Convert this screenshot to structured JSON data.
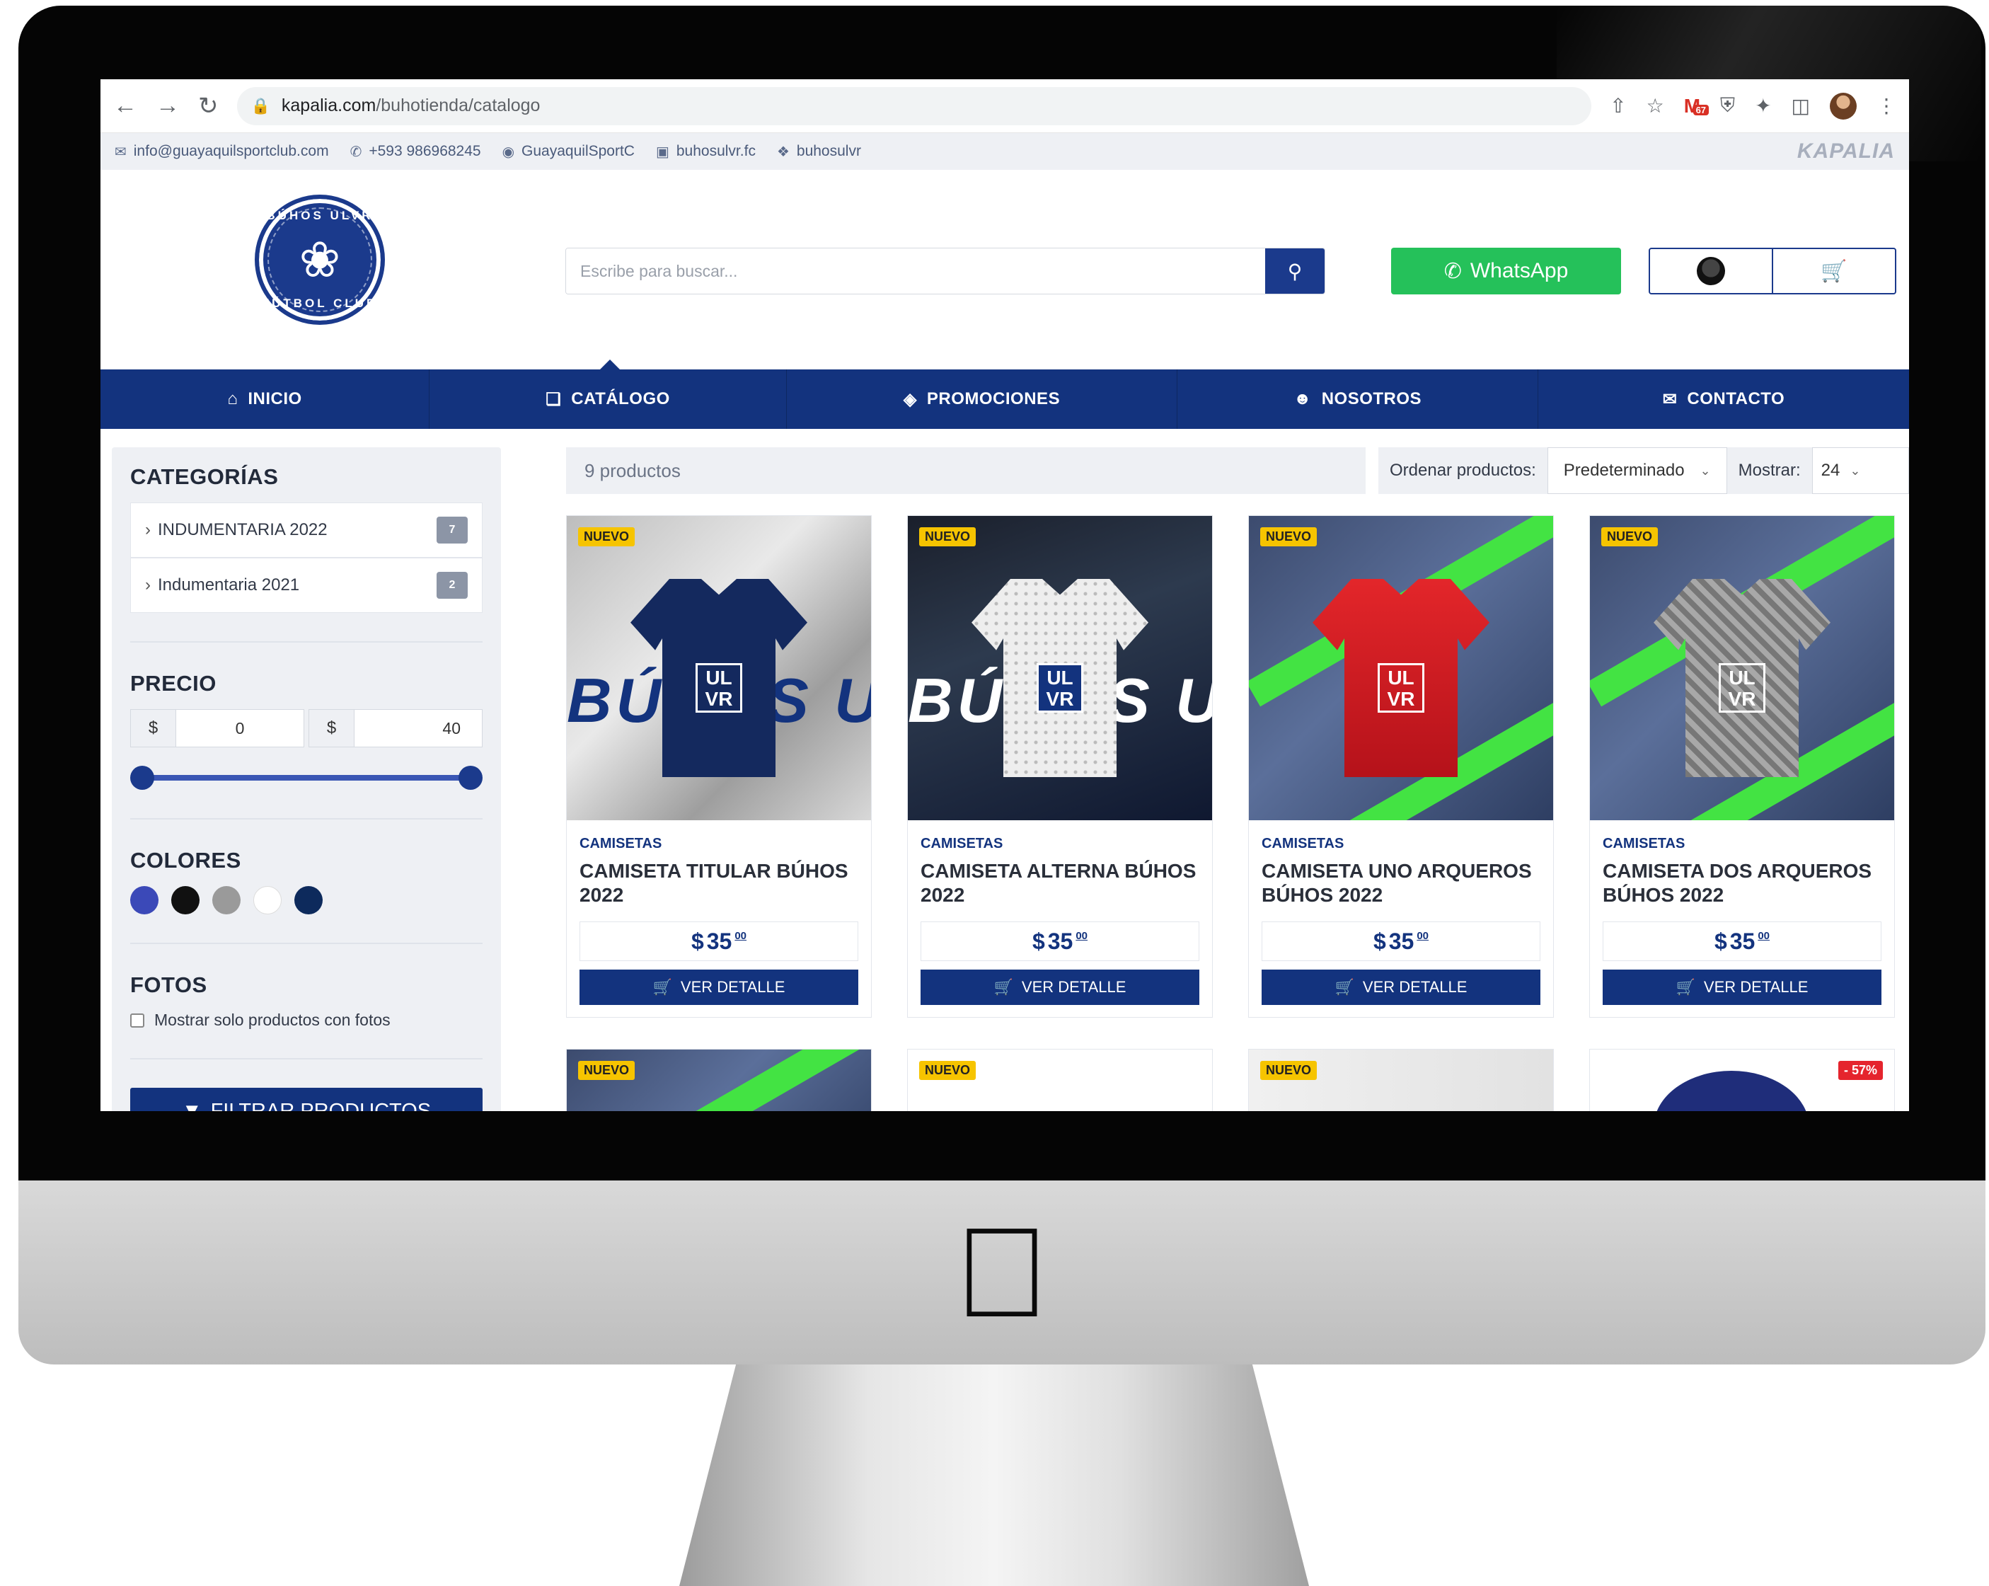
{
  "browser": {
    "url_host": "kapalia.com",
    "url_path": "/buhotienda/catalogo",
    "gmail_count": "67"
  },
  "topbar": {
    "email": "info@guayaquilsportclub.com",
    "phone": "+593 986968245",
    "facebook": "GuayaquilSportC",
    "instagram": "buhosulvr.fc",
    "twitter": "buhosulvr",
    "brand": "KAPALIA"
  },
  "logo": {
    "top": "BÚHOS ULVR",
    "bottom": "FÚTBOL CLUB"
  },
  "search": {
    "placeholder": "Escribe para buscar..."
  },
  "whatsapp_label": "WhatsApp",
  "nav": [
    {
      "label": "INICIO",
      "icon": "home-icon"
    },
    {
      "label": "CATÁLOGO",
      "icon": "catalog-icon"
    },
    {
      "label": "PROMOCIONES",
      "icon": "tag-icon"
    },
    {
      "label": "NOSOTROS",
      "icon": "users-icon"
    },
    {
      "label": "CONTACTO",
      "icon": "envelope-icon"
    }
  ],
  "sidebar": {
    "categories_title": "CATEGORÍAS",
    "categories": [
      {
        "label": "INDUMENTARIA 2022",
        "count": "7"
      },
      {
        "label": "Indumentaria 2021",
        "count": "2"
      }
    ],
    "price_title": "PRECIO",
    "currency": "$",
    "price_min": "0",
    "price_max": "40",
    "colors_title": "COLORES",
    "colors": [
      "#3b49b8",
      "#111111",
      "#9a9a9a",
      "#ffffff",
      "#0d2a5c"
    ],
    "photos_title": "FOTOS",
    "photos_checkbox": "Mostrar solo productos con fotos",
    "filter_button": "FILTRAR PRODUCTOS"
  },
  "toolbar": {
    "count": "9 productos",
    "sort_label": "Ordenar productos:",
    "sort_value": "Predeterminado",
    "show_label": "Mostrar:",
    "show_value": "24"
  },
  "products": [
    {
      "badge": "NUEVO",
      "category": "CAMISETAS",
      "name": "CAMISETA TITULAR BÚHOS 2022",
      "currency": "$",
      "price": "35",
      "cents": "00",
      "button": "VER DETALLE"
    },
    {
      "badge": "NUEVO",
      "category": "CAMISETAS",
      "name": "CAMISETA ALTERNA BÚHOS 2022",
      "currency": "$",
      "price": "35",
      "cents": "00",
      "button": "VER DETALLE"
    },
    {
      "badge": "NUEVO",
      "category": "CAMISETAS",
      "name": "CAMISETA UNO ARQUEROS BÚHOS 2022",
      "currency": "$",
      "price": "35",
      "cents": "00",
      "button": "VER DETALLE"
    },
    {
      "badge": "NUEVO",
      "category": "CAMISETAS",
      "name": "CAMISETA DOS ARQUEROS BÚHOS 2022",
      "currency": "$",
      "price": "35",
      "cents": "00",
      "button": "VER DETALLE"
    }
  ],
  "products_row2": [
    {
      "badge": "NUEVO"
    },
    {
      "badge": "NUEVO"
    },
    {
      "badge": "NUEVO"
    },
    {
      "badge": "- 57%"
    }
  ],
  "shirt_text": {
    "p1": "BÚHOS ULVR",
    "p2": "BÚHOS ULVR",
    "crest": "UL VR"
  },
  "colors": {
    "primary": "#13337e",
    "whatsapp": "#25c15a",
    "accent_green": "#43e343",
    "badge_new": "#f6c400"
  }
}
